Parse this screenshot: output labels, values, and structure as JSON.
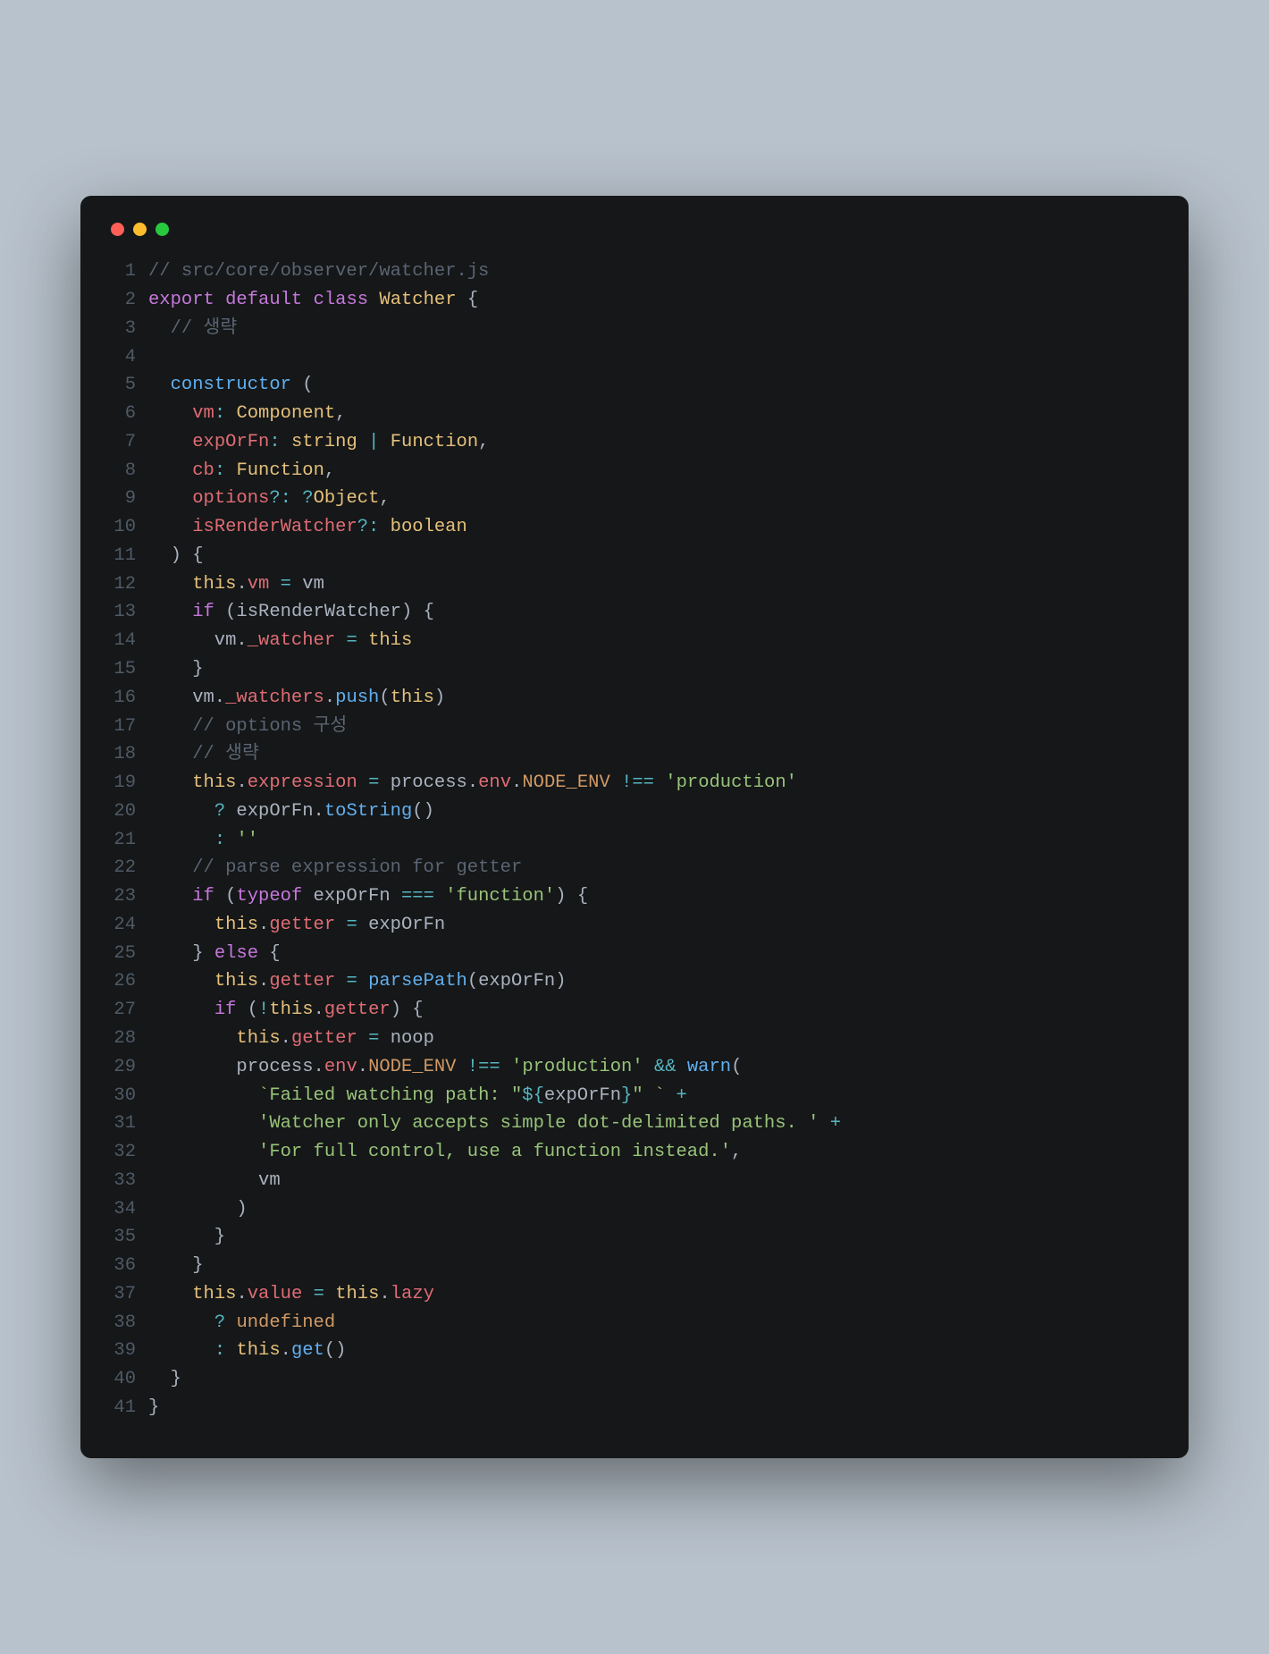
{
  "window": {
    "dots": [
      "red",
      "yellow",
      "green"
    ]
  },
  "colors": {
    "bg": "#151718",
    "page": "#b8c2cc",
    "red": "#ff5f56",
    "yellow": "#ffbd2e",
    "green": "#27c93f"
  },
  "lineCount": 41,
  "code": {
    "lines": [
      {
        "n": 1,
        "tokens": [
          [
            "c-comment",
            "// src/core/observer/watcher.js"
          ]
        ]
      },
      {
        "n": 2,
        "tokens": [
          [
            "c-kw",
            "export"
          ],
          [
            "c-plain",
            " "
          ],
          [
            "c-kw",
            "default"
          ],
          [
            "c-plain",
            " "
          ],
          [
            "c-kw",
            "class"
          ],
          [
            "c-plain",
            " "
          ],
          [
            "c-type",
            "Watcher"
          ],
          [
            "c-plain",
            " {"
          ]
        ]
      },
      {
        "n": 3,
        "tokens": [
          [
            "c-plain",
            "  "
          ],
          [
            "c-comment",
            "// 생략"
          ]
        ]
      },
      {
        "n": 4,
        "tokens": [
          [
            "c-plain",
            ""
          ]
        ]
      },
      {
        "n": 5,
        "tokens": [
          [
            "c-plain",
            "  "
          ],
          [
            "c-fn",
            "constructor"
          ],
          [
            "c-plain",
            " ("
          ]
        ]
      },
      {
        "n": 6,
        "tokens": [
          [
            "c-plain",
            "    "
          ],
          [
            "c-param",
            "vm"
          ],
          [
            "c-op",
            ":"
          ],
          [
            "c-plain",
            " "
          ],
          [
            "c-type",
            "Component"
          ],
          [
            "c-plain",
            ","
          ]
        ]
      },
      {
        "n": 7,
        "tokens": [
          [
            "c-plain",
            "    "
          ],
          [
            "c-param",
            "expOrFn"
          ],
          [
            "c-op",
            ":"
          ],
          [
            "c-plain",
            " "
          ],
          [
            "c-type",
            "string"
          ],
          [
            "c-plain",
            " "
          ],
          [
            "c-op",
            "|"
          ],
          [
            "c-plain",
            " "
          ],
          [
            "c-type",
            "Function"
          ],
          [
            "c-plain",
            ","
          ]
        ]
      },
      {
        "n": 8,
        "tokens": [
          [
            "c-plain",
            "    "
          ],
          [
            "c-param",
            "cb"
          ],
          [
            "c-op",
            ":"
          ],
          [
            "c-plain",
            " "
          ],
          [
            "c-type",
            "Function"
          ],
          [
            "c-plain",
            ","
          ]
        ]
      },
      {
        "n": 9,
        "tokens": [
          [
            "c-plain",
            "    "
          ],
          [
            "c-param",
            "options"
          ],
          [
            "c-op",
            "?:"
          ],
          [
            "c-plain",
            " "
          ],
          [
            "c-op",
            "?"
          ],
          [
            "c-type",
            "Object"
          ],
          [
            "c-plain",
            ","
          ]
        ]
      },
      {
        "n": 10,
        "tokens": [
          [
            "c-plain",
            "    "
          ],
          [
            "c-param",
            "isRenderWatcher"
          ],
          [
            "c-op",
            "?:"
          ],
          [
            "c-plain",
            " "
          ],
          [
            "c-type",
            "boolean"
          ]
        ]
      },
      {
        "n": 11,
        "tokens": [
          [
            "c-plain",
            "  ) {"
          ]
        ]
      },
      {
        "n": 12,
        "tokens": [
          [
            "c-plain",
            "    "
          ],
          [
            "c-this",
            "this"
          ],
          [
            "c-plain",
            "."
          ],
          [
            "c-prop",
            "vm"
          ],
          [
            "c-plain",
            " "
          ],
          [
            "c-op",
            "="
          ],
          [
            "c-plain",
            " vm"
          ]
        ]
      },
      {
        "n": 13,
        "tokens": [
          [
            "c-plain",
            "    "
          ],
          [
            "c-kw",
            "if"
          ],
          [
            "c-plain",
            " (isRenderWatcher) {"
          ]
        ]
      },
      {
        "n": 14,
        "tokens": [
          [
            "c-plain",
            "      vm."
          ],
          [
            "c-prop",
            "_watcher"
          ],
          [
            "c-plain",
            " "
          ],
          [
            "c-op",
            "="
          ],
          [
            "c-plain",
            " "
          ],
          [
            "c-this",
            "this"
          ]
        ]
      },
      {
        "n": 15,
        "tokens": [
          [
            "c-plain",
            "    }"
          ]
        ]
      },
      {
        "n": 16,
        "tokens": [
          [
            "c-plain",
            "    vm."
          ],
          [
            "c-prop",
            "_watchers"
          ],
          [
            "c-plain",
            "."
          ],
          [
            "c-fn",
            "push"
          ],
          [
            "c-plain",
            "("
          ],
          [
            "c-this",
            "this"
          ],
          [
            "c-plain",
            ")"
          ]
        ]
      },
      {
        "n": 17,
        "tokens": [
          [
            "c-plain",
            "    "
          ],
          [
            "c-comment",
            "// options 구성"
          ]
        ]
      },
      {
        "n": 18,
        "tokens": [
          [
            "c-plain",
            "    "
          ],
          [
            "c-comment",
            "// 생략"
          ]
        ]
      },
      {
        "n": 19,
        "tokens": [
          [
            "c-plain",
            "    "
          ],
          [
            "c-this",
            "this"
          ],
          [
            "c-plain",
            "."
          ],
          [
            "c-prop",
            "expression"
          ],
          [
            "c-plain",
            " "
          ],
          [
            "c-op",
            "="
          ],
          [
            "c-plain",
            " process."
          ],
          [
            "c-prop",
            "env"
          ],
          [
            "c-plain",
            "."
          ],
          [
            "c-const",
            "NODE_ENV"
          ],
          [
            "c-plain",
            " "
          ],
          [
            "c-op",
            "!=="
          ],
          [
            "c-plain",
            " "
          ],
          [
            "c-str",
            "'production'"
          ]
        ]
      },
      {
        "n": 20,
        "tokens": [
          [
            "c-plain",
            "      "
          ],
          [
            "c-op",
            "?"
          ],
          [
            "c-plain",
            " expOrFn."
          ],
          [
            "c-fn",
            "toString"
          ],
          [
            "c-plain",
            "()"
          ]
        ]
      },
      {
        "n": 21,
        "tokens": [
          [
            "c-plain",
            "      "
          ],
          [
            "c-op",
            ":"
          ],
          [
            "c-plain",
            " "
          ],
          [
            "c-str",
            "''"
          ]
        ]
      },
      {
        "n": 22,
        "tokens": [
          [
            "c-plain",
            "    "
          ],
          [
            "c-comment",
            "// parse expression for getter"
          ]
        ]
      },
      {
        "n": 23,
        "tokens": [
          [
            "c-plain",
            "    "
          ],
          [
            "c-kw",
            "if"
          ],
          [
            "c-plain",
            " ("
          ],
          [
            "c-kw",
            "typeof"
          ],
          [
            "c-plain",
            " expOrFn "
          ],
          [
            "c-op",
            "==="
          ],
          [
            "c-plain",
            " "
          ],
          [
            "c-str",
            "'function'"
          ],
          [
            "c-plain",
            ") {"
          ]
        ]
      },
      {
        "n": 24,
        "tokens": [
          [
            "c-plain",
            "      "
          ],
          [
            "c-this",
            "this"
          ],
          [
            "c-plain",
            "."
          ],
          [
            "c-prop",
            "getter"
          ],
          [
            "c-plain",
            " "
          ],
          [
            "c-op",
            "="
          ],
          [
            "c-plain",
            " expOrFn"
          ]
        ]
      },
      {
        "n": 25,
        "tokens": [
          [
            "c-plain",
            "    } "
          ],
          [
            "c-kw",
            "else"
          ],
          [
            "c-plain",
            " {"
          ]
        ]
      },
      {
        "n": 26,
        "tokens": [
          [
            "c-plain",
            "      "
          ],
          [
            "c-this",
            "this"
          ],
          [
            "c-plain",
            "."
          ],
          [
            "c-prop",
            "getter"
          ],
          [
            "c-plain",
            " "
          ],
          [
            "c-op",
            "="
          ],
          [
            "c-plain",
            " "
          ],
          [
            "c-fn",
            "parsePath"
          ],
          [
            "c-plain",
            "(expOrFn)"
          ]
        ]
      },
      {
        "n": 27,
        "tokens": [
          [
            "c-plain",
            "      "
          ],
          [
            "c-kw",
            "if"
          ],
          [
            "c-plain",
            " ("
          ],
          [
            "c-op",
            "!"
          ],
          [
            "c-this",
            "this"
          ],
          [
            "c-plain",
            "."
          ],
          [
            "c-prop",
            "getter"
          ],
          [
            "c-plain",
            ") {"
          ]
        ]
      },
      {
        "n": 28,
        "tokens": [
          [
            "c-plain",
            "        "
          ],
          [
            "c-this",
            "this"
          ],
          [
            "c-plain",
            "."
          ],
          [
            "c-prop",
            "getter"
          ],
          [
            "c-plain",
            " "
          ],
          [
            "c-op",
            "="
          ],
          [
            "c-plain",
            " noop"
          ]
        ]
      },
      {
        "n": 29,
        "tokens": [
          [
            "c-plain",
            "        process."
          ],
          [
            "c-prop",
            "env"
          ],
          [
            "c-plain",
            "."
          ],
          [
            "c-const",
            "NODE_ENV"
          ],
          [
            "c-plain",
            " "
          ],
          [
            "c-op",
            "!=="
          ],
          [
            "c-plain",
            " "
          ],
          [
            "c-str",
            "'production'"
          ],
          [
            "c-plain",
            " "
          ],
          [
            "c-op",
            "&&"
          ],
          [
            "c-plain",
            " "
          ],
          [
            "c-fn",
            "warn"
          ],
          [
            "c-plain",
            "("
          ]
        ]
      },
      {
        "n": 30,
        "tokens": [
          [
            "c-plain",
            "          "
          ],
          [
            "c-str",
            "`Failed watching path: \""
          ],
          [
            "c-op",
            "${"
          ],
          [
            "c-plain",
            "expOrFn"
          ],
          [
            "c-op",
            "}"
          ],
          [
            "c-str",
            "\" `"
          ],
          [
            "c-plain",
            " "
          ],
          [
            "c-op",
            "+"
          ]
        ]
      },
      {
        "n": 31,
        "tokens": [
          [
            "c-plain",
            "          "
          ],
          [
            "c-str",
            "'Watcher only accepts simple dot-delimited paths. '"
          ],
          [
            "c-plain",
            " "
          ],
          [
            "c-op",
            "+"
          ]
        ]
      },
      {
        "n": 32,
        "tokens": [
          [
            "c-plain",
            "          "
          ],
          [
            "c-str",
            "'For full control, use a function instead.'"
          ],
          [
            "c-plain",
            ","
          ]
        ]
      },
      {
        "n": 33,
        "tokens": [
          [
            "c-plain",
            "          vm"
          ]
        ]
      },
      {
        "n": 34,
        "tokens": [
          [
            "c-plain",
            "        )"
          ]
        ]
      },
      {
        "n": 35,
        "tokens": [
          [
            "c-plain",
            "      }"
          ]
        ]
      },
      {
        "n": 36,
        "tokens": [
          [
            "c-plain",
            "    }"
          ]
        ]
      },
      {
        "n": 37,
        "tokens": [
          [
            "c-plain",
            "    "
          ],
          [
            "c-this",
            "this"
          ],
          [
            "c-plain",
            "."
          ],
          [
            "c-prop",
            "value"
          ],
          [
            "c-plain",
            " "
          ],
          [
            "c-op",
            "="
          ],
          [
            "c-plain",
            " "
          ],
          [
            "c-this",
            "this"
          ],
          [
            "c-plain",
            "."
          ],
          [
            "c-prop",
            "lazy"
          ]
        ]
      },
      {
        "n": 38,
        "tokens": [
          [
            "c-plain",
            "      "
          ],
          [
            "c-op",
            "?"
          ],
          [
            "c-plain",
            " "
          ],
          [
            "c-undef",
            "undefined"
          ]
        ]
      },
      {
        "n": 39,
        "tokens": [
          [
            "c-plain",
            "      "
          ],
          [
            "c-op",
            ":"
          ],
          [
            "c-plain",
            " "
          ],
          [
            "c-this",
            "this"
          ],
          [
            "c-plain",
            "."
          ],
          [
            "c-fn",
            "get"
          ],
          [
            "c-plain",
            "()"
          ]
        ]
      },
      {
        "n": 40,
        "tokens": [
          [
            "c-plain",
            "  }"
          ]
        ]
      },
      {
        "n": 41,
        "tokens": [
          [
            "c-plain",
            "}"
          ]
        ]
      }
    ]
  }
}
